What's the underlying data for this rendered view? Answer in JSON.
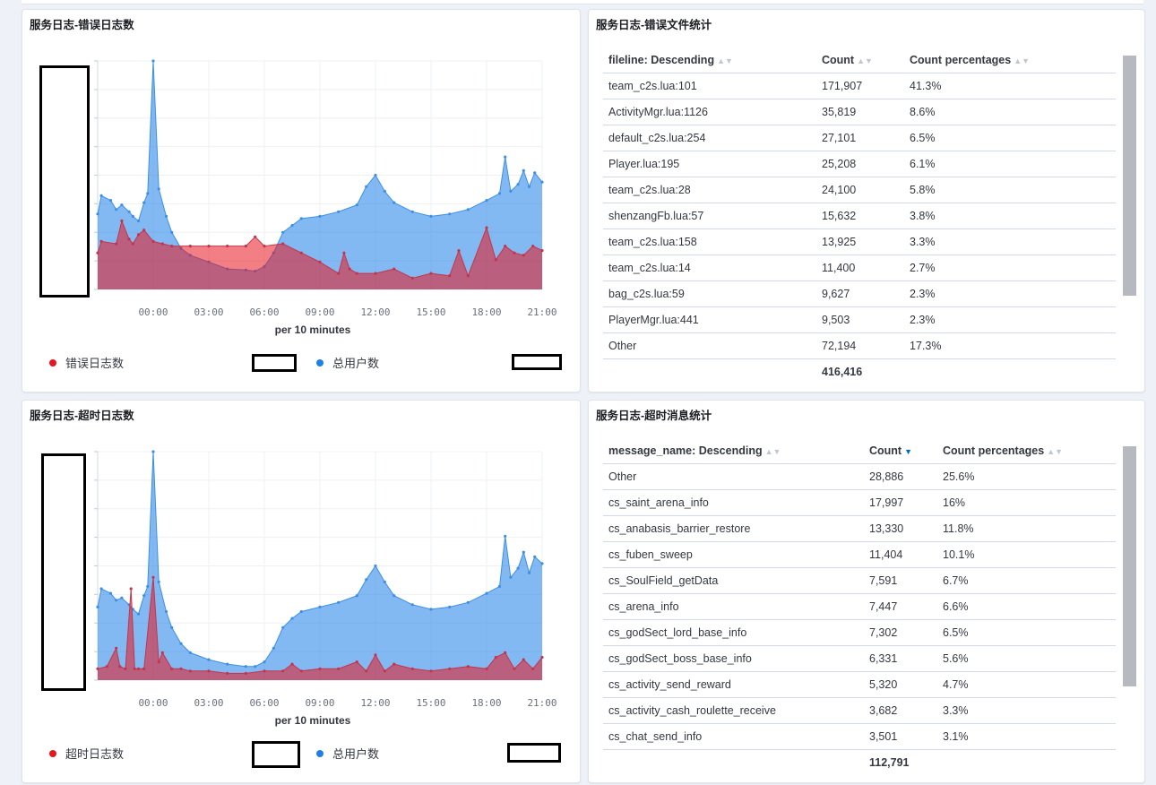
{
  "panels": {
    "error_log": {
      "title": "服务日志-错误日志数",
      "xlabel": "per 10 minutes",
      "ticks": [
        "00:00",
        "03:00",
        "06:00",
        "09:00",
        "12:00",
        "15:00",
        "18:00",
        "21:00"
      ],
      "legend": [
        {
          "label": "错误日志数",
          "color": "#e7161e"
        },
        {
          "label": "总用户数",
          "color": "#1e7fe8"
        }
      ]
    },
    "error_files": {
      "title": "服务日志-错误文件统计",
      "headers": [
        "fileline: Descending",
        "Count",
        "Count percentages"
      ],
      "rows": [
        [
          "team_c2s.lua:101",
          "171,907",
          "41.3%"
        ],
        [
          "ActivityMgr.lua:1126",
          "35,819",
          "8.6%"
        ],
        [
          "default_c2s.lua:254",
          "27,101",
          "6.5%"
        ],
        [
          "Player.lua:195",
          "25,208",
          "6.1%"
        ],
        [
          "team_c2s.lua:28",
          "24,100",
          "5.8%"
        ],
        [
          "shenzangFb.lua:57",
          "15,632",
          "3.8%"
        ],
        [
          "team_c2s.lua:158",
          "13,925",
          "3.3%"
        ],
        [
          "team_c2s.lua:14",
          "11,400",
          "2.7%"
        ],
        [
          "bag_c2s.lua:59",
          "9,627",
          "2.3%"
        ],
        [
          "PlayerMgr.lua:441",
          "9,503",
          "2.3%"
        ],
        [
          "Other",
          "72,194",
          "17.3%"
        ]
      ],
      "total": "416,416"
    },
    "timeout_log": {
      "title": "服务日志-超时日志数",
      "xlabel": "per 10 minutes",
      "ticks": [
        "00:00",
        "03:00",
        "06:00",
        "09:00",
        "12:00",
        "15:00",
        "18:00",
        "21:00"
      ],
      "legend": [
        {
          "label": "超时日志数",
          "color": "#e7161e"
        },
        {
          "label": "总用户数",
          "color": "#1e7fe8"
        }
      ]
    },
    "timeout_msgs": {
      "title": "服务日志-超时消息统计",
      "headers": [
        "message_name: Descending",
        "Count",
        "Count percentages"
      ],
      "rows": [
        [
          "Other",
          "28,886",
          "25.6%"
        ],
        [
          "cs_saint_arena_info",
          "17,997",
          "16%"
        ],
        [
          "cs_anabasis_barrier_restore",
          "13,330",
          "11.8%"
        ],
        [
          "cs_fuben_sweep",
          "11,404",
          "10.1%"
        ],
        [
          "cs_SoulField_getData",
          "7,591",
          "6.7%"
        ],
        [
          "cs_arena_info",
          "7,447",
          "6.6%"
        ],
        [
          "cs_godSect_lord_base_info",
          "7,302",
          "6.5%"
        ],
        [
          "cs_godSect_boss_base_info",
          "6,331",
          "5.6%"
        ],
        [
          "cs_activity_send_reward",
          "5,320",
          "4.7%"
        ],
        [
          "cs_activity_cash_roulette_receive",
          "3,682",
          "3.3%"
        ],
        [
          "cs_chat_send_info",
          "3,501",
          "3.1%"
        ]
      ],
      "total": "112,791"
    }
  },
  "chart_data": [
    {
      "type": "area",
      "title": "服务日志-错误日志数",
      "xlabel": "per 10 minutes",
      "x_ticks": [
        "00:00",
        "03:00",
        "06:00",
        "09:00",
        "12:00",
        "15:00",
        "18:00",
        "21:00"
      ],
      "x_range_hours": [
        -3,
        21
      ],
      "series": [
        {
          "name": "总用户数",
          "color": "#1e7fe8",
          "x": [
            -3,
            -2.8,
            -2.3,
            -2,
            -1.7,
            -1.3,
            -1.1,
            -0.8,
            -0.5,
            -0.3,
            0,
            0.3,
            0.7,
            1,
            1.5,
            2,
            3,
            4,
            5,
            5.5,
            6,
            6.5,
            7,
            7.5,
            8,
            9,
            10,
            11,
            11.5,
            12,
            12.5,
            13,
            14,
            15,
            16,
            17,
            18,
            18.7,
            19,
            19.3,
            19.7,
            20,
            20.3,
            20.6,
            21
          ],
          "values": [
            0.33,
            0.41,
            0.39,
            0.35,
            0.37,
            0.34,
            0.32,
            0.3,
            0.38,
            0.42,
            1.0,
            0.44,
            0.32,
            0.25,
            0.18,
            0.15,
            0.12,
            0.09,
            0.085,
            0.08,
            0.1,
            0.16,
            0.25,
            0.28,
            0.31,
            0.32,
            0.34,
            0.37,
            0.45,
            0.5,
            0.43,
            0.38,
            0.34,
            0.32,
            0.33,
            0.35,
            0.39,
            0.42,
            0.58,
            0.43,
            0.46,
            0.52,
            0.45,
            0.51,
            0.47
          ]
        },
        {
          "name": "错误日志数",
          "color": "#e7161e",
          "x": [
            -3,
            -2.8,
            -2,
            -1.7,
            -1.3,
            -1.1,
            -0.8,
            -0.5,
            0,
            0.5,
            1,
            2,
            3,
            4,
            5,
            5.5,
            6,
            7,
            8,
            9,
            10,
            10.3,
            10.6,
            11,
            12,
            13,
            14,
            15,
            16,
            16.5,
            17,
            18,
            18.5,
            19,
            19.5,
            20,
            20.5,
            21
          ],
          "values": [
            0.16,
            0.21,
            0.2,
            0.3,
            0.22,
            0.2,
            0.24,
            0.26,
            0.21,
            0.2,
            0.19,
            0.19,
            0.19,
            0.19,
            0.19,
            0.23,
            0.19,
            0.2,
            0.16,
            0.12,
            0.07,
            0.16,
            0.09,
            0.07,
            0.07,
            0.09,
            0.05,
            0.07,
            0.06,
            0.17,
            0.06,
            0.27,
            0.13,
            0.19,
            0.16,
            0.15,
            0.19,
            0.17
          ]
        }
      ]
    },
    {
      "type": "area",
      "title": "服务日志-超时日志数",
      "xlabel": "per 10 minutes",
      "x_ticks": [
        "00:00",
        "03:00",
        "06:00",
        "09:00",
        "12:00",
        "15:00",
        "18:00",
        "21:00"
      ],
      "x_range_hours": [
        -3,
        21
      ],
      "series": [
        {
          "name": "总用户数",
          "color": "#1e7fe8",
          "x": [
            -3,
            -2.8,
            -2.3,
            -2,
            -1.7,
            -1.3,
            -1.1,
            -0.8,
            -0.5,
            -0.3,
            0,
            0.3,
            0.7,
            1,
            1.5,
            2,
            3,
            4,
            5,
            5.5,
            6,
            6.5,
            7,
            7.5,
            8,
            9,
            10,
            11,
            11.5,
            12,
            12.5,
            13,
            14,
            15,
            16,
            17,
            18,
            18.7,
            19,
            19.3,
            19.7,
            20,
            20.3,
            20.6,
            21
          ],
          "values": [
            0.32,
            0.4,
            0.38,
            0.35,
            0.36,
            0.33,
            0.31,
            0.29,
            0.37,
            0.41,
            1.0,
            0.43,
            0.3,
            0.23,
            0.16,
            0.12,
            0.09,
            0.07,
            0.06,
            0.06,
            0.08,
            0.14,
            0.23,
            0.27,
            0.3,
            0.32,
            0.34,
            0.37,
            0.44,
            0.5,
            0.43,
            0.37,
            0.33,
            0.31,
            0.32,
            0.34,
            0.38,
            0.41,
            0.63,
            0.45,
            0.49,
            0.56,
            0.47,
            0.54,
            0.51
          ]
        },
        {
          "name": "超时日志数",
          "color": "#e7161e",
          "x": [
            -3,
            -2.5,
            -2,
            -1.8,
            -1.5,
            -1.2,
            -1,
            -0.8,
            -0.5,
            0,
            0.3,
            0.5,
            1,
            1.5,
            2,
            3,
            4,
            5,
            6,
            7,
            7.5,
            8,
            9,
            10,
            11,
            11.5,
            12,
            12.5,
            13,
            14,
            15,
            16,
            17,
            18,
            18.5,
            19,
            19.5,
            20,
            20.5,
            21
          ],
          "values": [
            0.05,
            0.06,
            0.14,
            0.06,
            0.05,
            0.4,
            0.05,
            0.05,
            0.05,
            0.45,
            0.08,
            0.12,
            0.05,
            0.05,
            0.04,
            0.04,
            0.03,
            0.03,
            0.04,
            0.04,
            0.07,
            0.04,
            0.05,
            0.05,
            0.08,
            0.04,
            0.11,
            0.04,
            0.07,
            0.05,
            0.04,
            0.05,
            0.06,
            0.05,
            0.1,
            0.12,
            0.05,
            0.09,
            0.05,
            0.1
          ]
        }
      ]
    }
  ]
}
